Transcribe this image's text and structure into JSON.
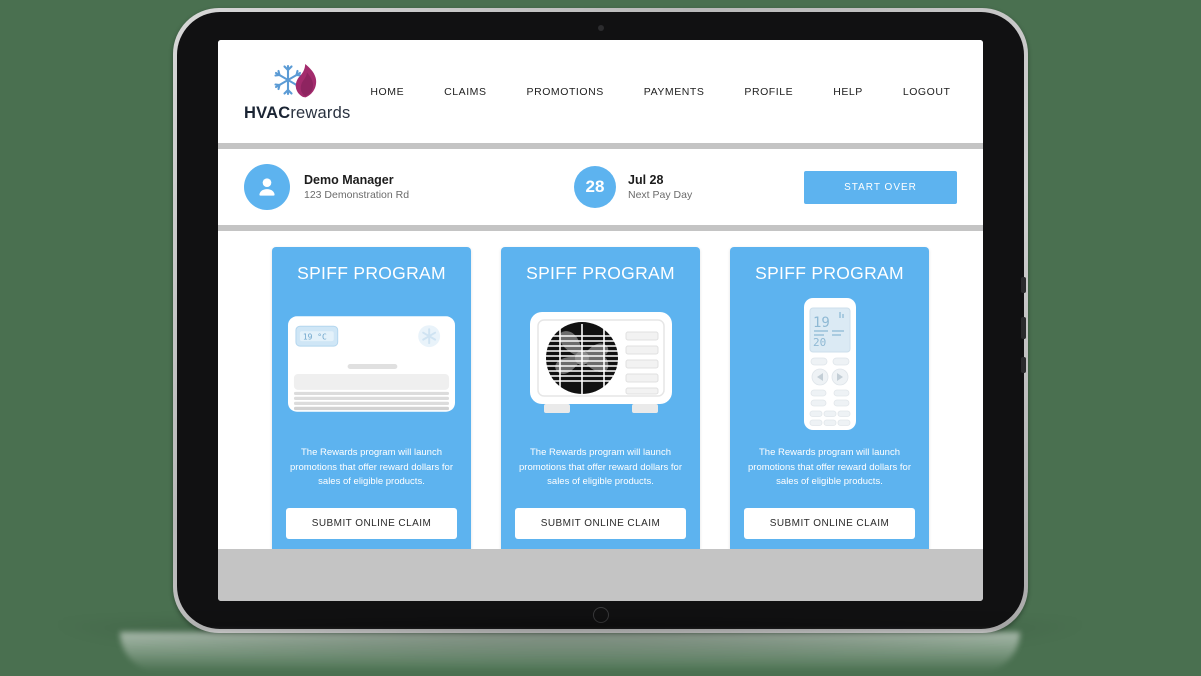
{
  "brand": {
    "name_bold": "HVAC",
    "name_light": "rewards",
    "logo_icon": "snowflake-flame-icon",
    "snowflake_color": "#5b9bd5",
    "flame_color": "#a32b6d"
  },
  "nav": {
    "items": [
      {
        "label": "HOME",
        "name": "nav-home"
      },
      {
        "label": "CLAIMS",
        "name": "nav-claims"
      },
      {
        "label": "PROMOTIONS",
        "name": "nav-promotions"
      },
      {
        "label": "PAYMENTS",
        "name": "nav-payments"
      },
      {
        "label": "PROFILE",
        "name": "nav-profile"
      },
      {
        "label": "HELP",
        "name": "nav-help"
      },
      {
        "label": "LOGOUT",
        "name": "nav-logout"
      }
    ]
  },
  "status_bar": {
    "avatar_icon": "user-avatar-icon",
    "user_name": "Demo Manager",
    "user_address": "123 Demonstration Rd",
    "payday_day": "28",
    "payday_date": "Jul 28",
    "payday_label": "Next Pay Day",
    "start_over_label": "START OVER",
    "accent_color": "#5db3ef"
  },
  "cards": [
    {
      "title": "SPIFF PROGRAM",
      "art_icon": "wall-mounted-ac-unit-icon",
      "description": "The Rewards program will launch promotions that offer reward dollars for sales of eligible products.",
      "button_label": "SUBMIT ONLINE CLAIM"
    },
    {
      "title": "SPIFF PROGRAM",
      "art_icon": "outdoor-condenser-unit-icon",
      "description": "The Rewards program will launch promotions that offer reward dollars for sales of eligible products.",
      "button_label": "SUBMIT ONLINE CLAIM"
    },
    {
      "title": "SPIFF PROGRAM",
      "art_icon": "ac-remote-control-icon",
      "description": "The Rewards program will launch promotions that offer reward dollars for sales of eligible products.",
      "button_label": "SUBMIT ONLINE CLAIM"
    }
  ],
  "remote_display": {
    "temp_main": "19",
    "temp_secondary": "20"
  },
  "theme": {
    "page_background": "#4a7050",
    "screen_background": "#c4c4c4",
    "panel_background": "#ffffff",
    "card_blue": "#5db3ef"
  }
}
